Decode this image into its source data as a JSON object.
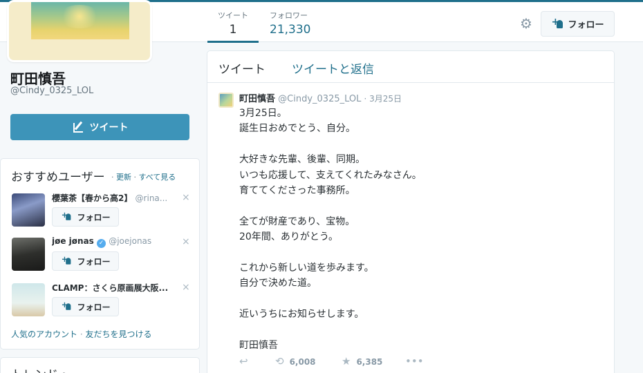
{
  "profile": {
    "name": "町田慎吾",
    "handle": "@Cindy_0325_LOL",
    "tweet_button": "ツイート"
  },
  "stats": [
    {
      "label": "ツイート",
      "value": "1"
    },
    {
      "label": "フォロワー",
      "value": "21,330"
    }
  ],
  "header": {
    "settings_icon": "gear-icon",
    "follow_label": "フォロー"
  },
  "who_to_follow": {
    "title": "おすすめユーザー",
    "dot": "·",
    "refresh": "更新",
    "view_all": "すべて見る",
    "users": [
      {
        "name": "櫻葉茶【春から高2】",
        "handle": "@rina...",
        "follow": "フォロー"
      },
      {
        "name": "jøe jønas",
        "handle": "@joejonas",
        "follow": "フォロー",
        "verified": true
      },
      {
        "name": "CLAMP：さくら原画展大阪...",
        "handle": "",
        "follow": "フォロー"
      }
    ],
    "close": "×",
    "popular": "人気のアカウント",
    "find_friends": "友だちを見つける"
  },
  "trends": {
    "title": "トレンド・"
  },
  "timeline": {
    "tabs": [
      "ツイート",
      "ツイートと返信"
    ],
    "tweet": {
      "name": "町田慎吾",
      "handle": "@Cindy_0325_LOL",
      "time": "· 3月25日",
      "lines": [
        "3月25日。",
        "誕生日おめでとう、自分。",
        "",
        "大好きな先輩、後輩、同期。",
        "いつも応援して、支えてくれたみなさん。",
        "育ててくださった事務所。",
        "",
        "全てが財産であり、宝物。",
        "20年間、ありがとう。",
        "",
        "これから新しい道を歩みます。",
        "自分で決めた道。",
        "",
        "近いうちにお知らせします。",
        "",
        "町田慎吾"
      ],
      "retweets": "6,008",
      "likes": "6,385"
    }
  },
  "colors": {
    "accent": "#1f6f8b",
    "button": "#3d94b9"
  }
}
